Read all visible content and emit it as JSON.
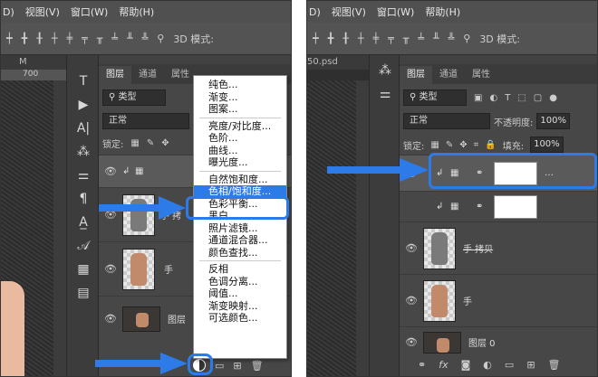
{
  "menubar": {
    "items": [
      "D)",
      "视图(V)",
      "窗口(W)",
      "帮助(H)"
    ]
  },
  "optionbar": {
    "mode_3d": "3D 模式:"
  },
  "left": {
    "file_label": "M",
    "ruler": "700",
    "tabs": [
      "图层",
      "通道",
      "属性"
    ],
    "filter": "类型",
    "blend": "正常",
    "lock_label": "锁定:",
    "layers": [
      {
        "name": "手 拷贝",
        "partial": "手 拷"
      },
      {
        "name": "手"
      },
      {
        "name": "图层",
        "partial": "图层"
      }
    ],
    "menu": {
      "group1": [
        "纯色...",
        "渐变...",
        "图案..."
      ],
      "group2": [
        "亮度/对比度...",
        "色阶...",
        "曲线...",
        "曝光度..."
      ],
      "group3": [
        "自然饱和度...",
        "色相/饱和度...",
        "色彩平衡...",
        "黑白...",
        "照片滤镜...",
        "通道混合器...",
        "颜色查找..."
      ],
      "group4": [
        "反相",
        "色调分离...",
        "阈值...",
        "渐变映射...",
        "可选颜色..."
      ]
    }
  },
  "right": {
    "file_label": "50.psd",
    "tabs": [
      "图层",
      "通道",
      "属性"
    ],
    "filter": "类型",
    "blend": "正常",
    "opacity_label": "不透明度:",
    "opacity_value": "100%",
    "lock_label": "锁定:",
    "fill_label": "填充:",
    "fill_value": "100%",
    "layers": [
      {
        "name": ""
      },
      {
        "name": ""
      },
      {
        "name": "手 拷贝"
      },
      {
        "name": "手"
      },
      {
        "name": "图层 0"
      }
    ]
  },
  "colors": {
    "highlight": "#2d7be9",
    "panel": "#474747"
  }
}
